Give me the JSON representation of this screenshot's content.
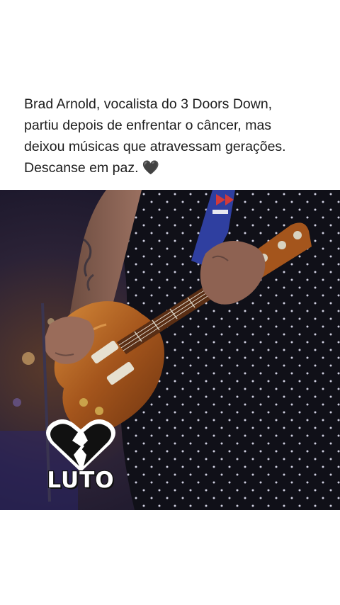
{
  "post": {
    "caption": "Brad Arnold, vocalista do 3 Doors Down,\npartiu depois de enfrentar o câncer, mas\ndeixou músicas que atravessam gerações.\nDescanse em paz. 🖤"
  },
  "photo": {
    "subject": "guitarist-playing-electric-guitar",
    "badge": {
      "icon": "broken-heart-icon",
      "label": "LUTO"
    }
  },
  "colors": {
    "background": "#ffffff",
    "text": "#1c1c1c",
    "heart": "#111111",
    "badge_text": "#ffffff"
  }
}
